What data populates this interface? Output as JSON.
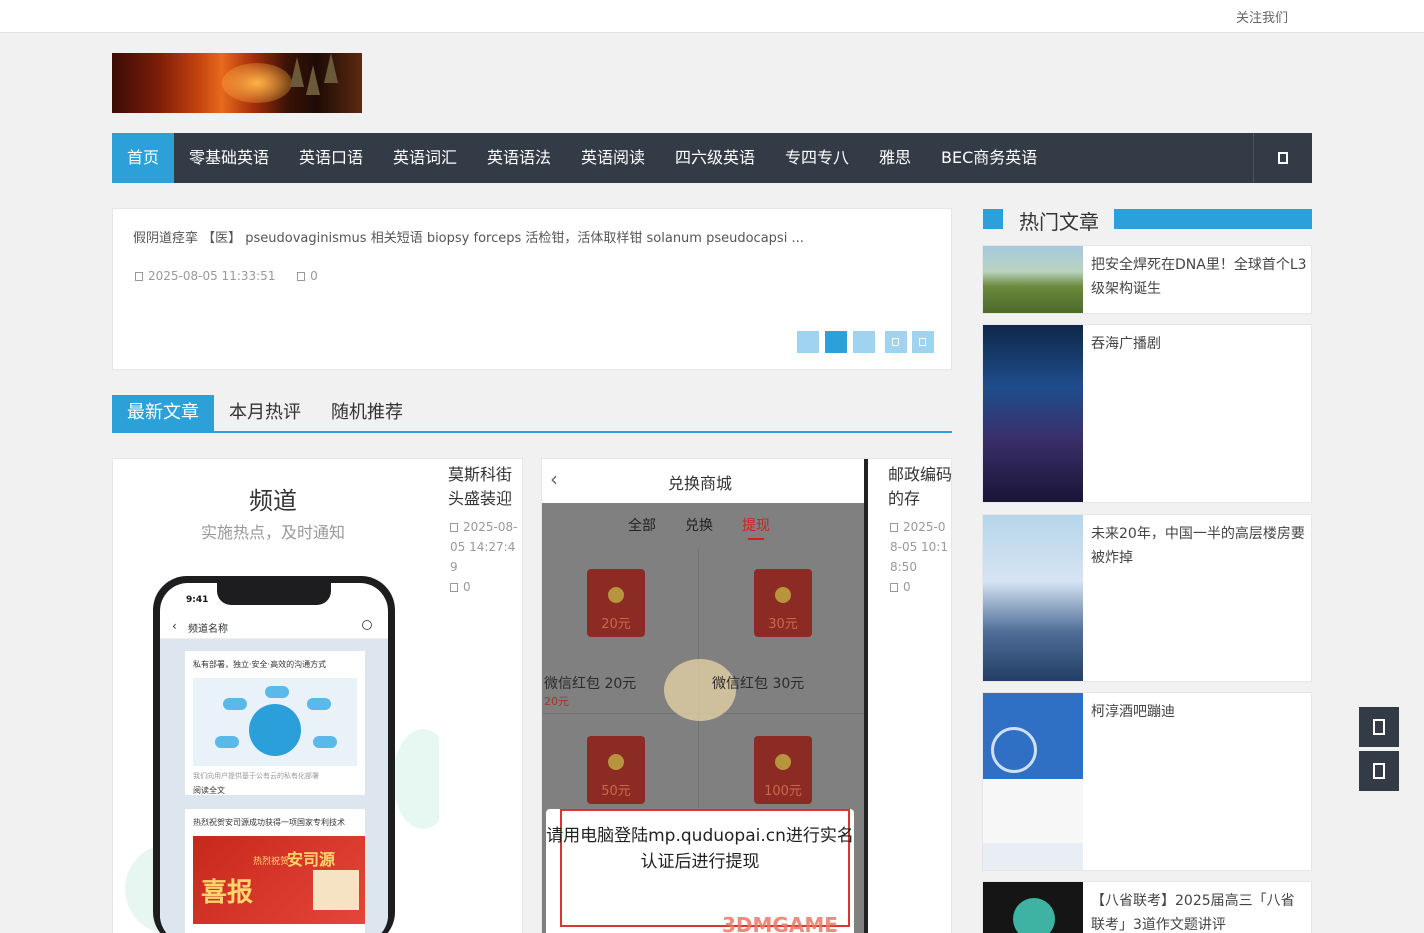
{
  "topbar": {
    "follow_label": "关注我们"
  },
  "nav": {
    "items": [
      {
        "label": "首页",
        "active": true
      },
      {
        "label": "零基础英语"
      },
      {
        "label": "英语口语"
      },
      {
        "label": "英语词汇"
      },
      {
        "label": "英语语法"
      },
      {
        "label": "英语阅读"
      },
      {
        "label": "四六级英语"
      },
      {
        "label": "专四专八"
      },
      {
        "label": "雅思"
      },
      {
        "label": "BEC商务英语"
      }
    ],
    "search_icon": "search-icon"
  },
  "slider": {
    "text": "假阴道痉挛 【医】 pseudovaginismus 相关短语 biopsy forceps 活检钳，活体取样钳 solanum pseudocapsi ...",
    "date": "2025-08-05 11:33:51",
    "comments": "0",
    "page_count": 5,
    "current_page": 2
  },
  "tabs": [
    {
      "label": "最新文章",
      "active": true
    },
    {
      "label": "本月热评"
    },
    {
      "label": "随机推荐"
    }
  ],
  "articles": [
    {
      "title": "莫斯科街头盛装迎",
      "date": "2025-08-05 14:27:49",
      "comments": "0",
      "thumb": {
        "heading": "频道",
        "subheading": "实施热点，及时通知",
        "phone_time": "9:41",
        "phone_title": "频道名称",
        "panel1_title": "私有部署，独立·安全·高效的沟通方式",
        "panel1_note": "我们向用户提供基于公有云的私有化部署",
        "panel1_read": "阅读全文",
        "panel2_title": "热烈祝贺安司源成功获得一项国家专利技术",
        "panel2_line1": "热烈祝贺",
        "panel2_line2": "安司源",
        "panel2_big": "喜报"
      }
    },
    {
      "title": "邮政编码的存",
      "date": "2025-08-05 10:18:50",
      "comments": "0",
      "thumb": {
        "title": "兑换商城",
        "tabs": [
          "全部",
          "兑换",
          "提现"
        ],
        "active_tab": "提现",
        "envelopes": [
          "20元",
          "30元",
          "50元",
          "100元"
        ],
        "labels": [
          "微信红包 20元",
          "微信红包 30元"
        ],
        "sub_label": "20元",
        "dialog": "请用电脑登陆mp.quduopai.cn进行实名认证后进行提现",
        "watermark": "3DMGAME"
      }
    }
  ],
  "sidebar": {
    "title": "热门文章",
    "items": [
      {
        "title": "把安全焊死在DNA里！全球首个L3级架构诞生"
      },
      {
        "title": "吞海广播剧"
      },
      {
        "title": "未来20年，中国一半的高层楼房要被炸掉"
      },
      {
        "title": "柯淳酒吧蹦迪"
      },
      {
        "title": "【八省联考】2025届高三「八省联考」3道作文题讲评"
      }
    ]
  },
  "float_buttons": [
    "qrcode-icon",
    "back-to-top-icon"
  ]
}
